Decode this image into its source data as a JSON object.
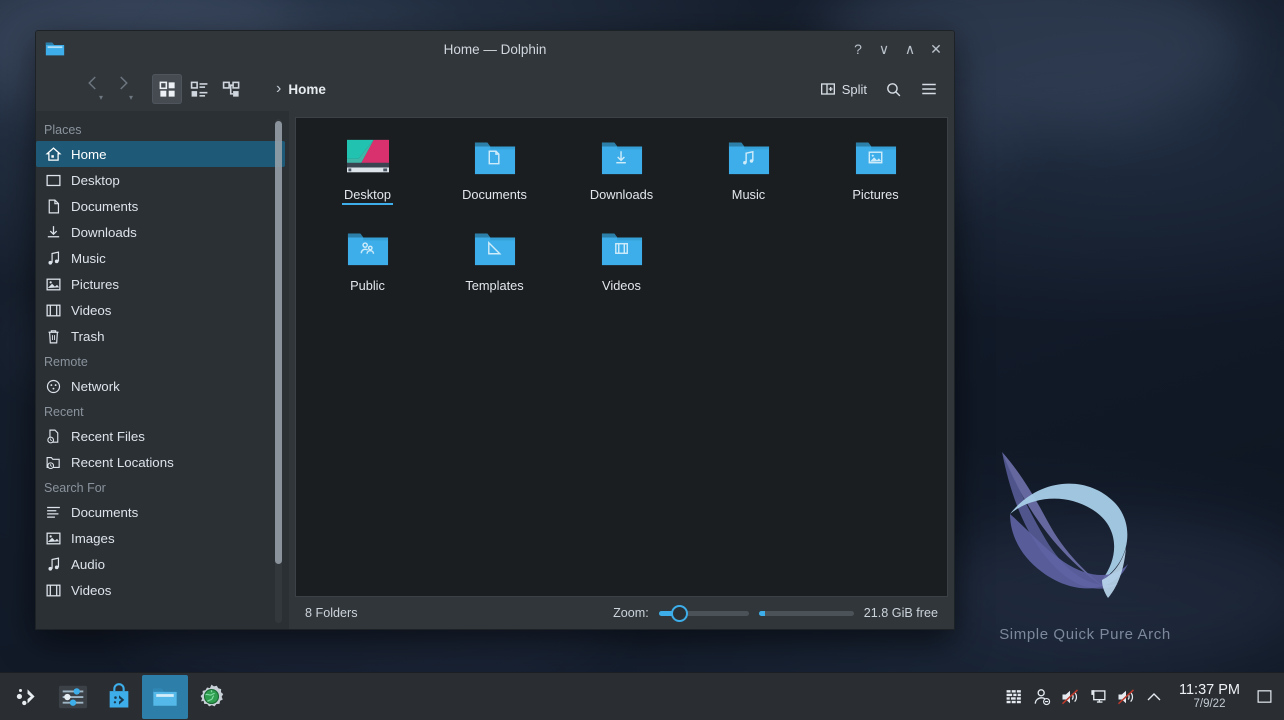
{
  "window": {
    "title": "Home — Dolphin",
    "icon": "folder-icon",
    "controls": [
      {
        "name": "help-button",
        "glyph": "?"
      },
      {
        "name": "minimize-button",
        "glyph": "∨"
      },
      {
        "name": "maximize-button",
        "glyph": "∧"
      },
      {
        "name": "close-button",
        "glyph": "✕"
      }
    ]
  },
  "toolbar": {
    "back_label": "",
    "forward_label": "",
    "view_modes": [
      {
        "name": "view-mode-icons",
        "icon": "grid-icon",
        "active": true
      },
      {
        "name": "view-mode-details",
        "icon": "list-icon",
        "active": false
      },
      {
        "name": "view-mode-tree",
        "icon": "tree-icon",
        "active": false
      }
    ],
    "breadcrumb_separator": "›",
    "breadcrumb": "Home",
    "split_label": "Split",
    "search_icon": "search-icon",
    "menu_icon": "hamburger-menu-icon"
  },
  "sidebar": {
    "groups": [
      {
        "title": "Places",
        "items": [
          {
            "label": "Home",
            "icon": "home-icon",
            "selected": true
          },
          {
            "label": "Desktop",
            "icon": "desktop-icon",
            "selected": false
          },
          {
            "label": "Documents",
            "icon": "document-icon",
            "selected": false
          },
          {
            "label": "Downloads",
            "icon": "download-icon",
            "selected": false
          },
          {
            "label": "Music",
            "icon": "music-note-icon",
            "selected": false
          },
          {
            "label": "Pictures",
            "icon": "image-icon",
            "selected": false
          },
          {
            "label": "Videos",
            "icon": "film-icon",
            "selected": false
          },
          {
            "label": "Trash",
            "icon": "trash-icon",
            "selected": false
          }
        ]
      },
      {
        "title": "Remote",
        "items": [
          {
            "label": "Network",
            "icon": "network-icon",
            "selected": false
          }
        ]
      },
      {
        "title": "Recent",
        "items": [
          {
            "label": "Recent Files",
            "icon": "recent-file-icon",
            "selected": false
          },
          {
            "label": "Recent Locations",
            "icon": "recent-folder-icon",
            "selected": false
          }
        ]
      },
      {
        "title": "Search For",
        "items": [
          {
            "label": "Documents",
            "icon": "text-lines-icon",
            "selected": false
          },
          {
            "label": "Images",
            "icon": "image-icon",
            "selected": false
          },
          {
            "label": "Audio",
            "icon": "music-note-icon",
            "selected": false
          },
          {
            "label": "Videos",
            "icon": "film-icon",
            "selected": false
          }
        ]
      }
    ]
  },
  "files": [
    {
      "label": "Desktop",
      "icon": "wallpaper-thumbnail-icon",
      "hovered": true
    },
    {
      "label": "Documents",
      "icon": "folder-documents-icon",
      "hovered": false
    },
    {
      "label": "Downloads",
      "icon": "folder-downloads-icon",
      "hovered": false
    },
    {
      "label": "Music",
      "icon": "folder-music-icon",
      "hovered": false
    },
    {
      "label": "Pictures",
      "icon": "folder-pictures-icon",
      "hovered": false
    },
    {
      "label": "Public",
      "icon": "folder-public-icon",
      "hovered": false
    },
    {
      "label": "Templates",
      "icon": "folder-templates-icon",
      "hovered": false
    },
    {
      "label": "Videos",
      "icon": "folder-videos-icon",
      "hovered": false
    }
  ],
  "statusbar": {
    "count": "8 Folders",
    "zoom_label": "Zoom:",
    "free_space": "21.8 GiB free"
  },
  "taskbar": {
    "launchers": [
      {
        "name": "application-launcher",
        "icon": "kde-launcher-icon",
        "active": false
      },
      {
        "name": "taskbar-item-settings-sliders",
        "icon": "sliders-icon",
        "active": false
      },
      {
        "name": "taskbar-item-discover",
        "icon": "shopping-bag-icon",
        "active": false
      },
      {
        "name": "taskbar-item-dolphin",
        "icon": "folder-icon",
        "active": true
      },
      {
        "name": "taskbar-item-system-settings",
        "icon": "globe-gear-icon",
        "active": false
      }
    ],
    "tray": [
      {
        "name": "tray-keyboard-layout-icon",
        "icon": "keyboard-grid-icon"
      },
      {
        "name": "tray-user-icon",
        "icon": "user-icon"
      },
      {
        "name": "tray-volume-muted-icon",
        "icon": "speaker-muted-icon"
      },
      {
        "name": "tray-display-icon",
        "icon": "display-icon"
      },
      {
        "name": "tray-microphone-muted-icon",
        "icon": "speaker-muted-icon"
      },
      {
        "name": "tray-expand-icon",
        "icon": "chevron-up-icon"
      }
    ],
    "clock": {
      "time": "11:37 PM",
      "date": "7/9/22"
    },
    "show_desktop_icon": "show-desktop-icon"
  },
  "wallpaper": {
    "caption": "Simple Quick Pure Arch"
  },
  "colors": {
    "accent": "#3daee9",
    "window_bg": "#31363b",
    "sidebar_bg": "#2b3035",
    "view_bg": "#1b1e20",
    "selection": "#1e5a77",
    "folder_blue": "#3daee9"
  }
}
